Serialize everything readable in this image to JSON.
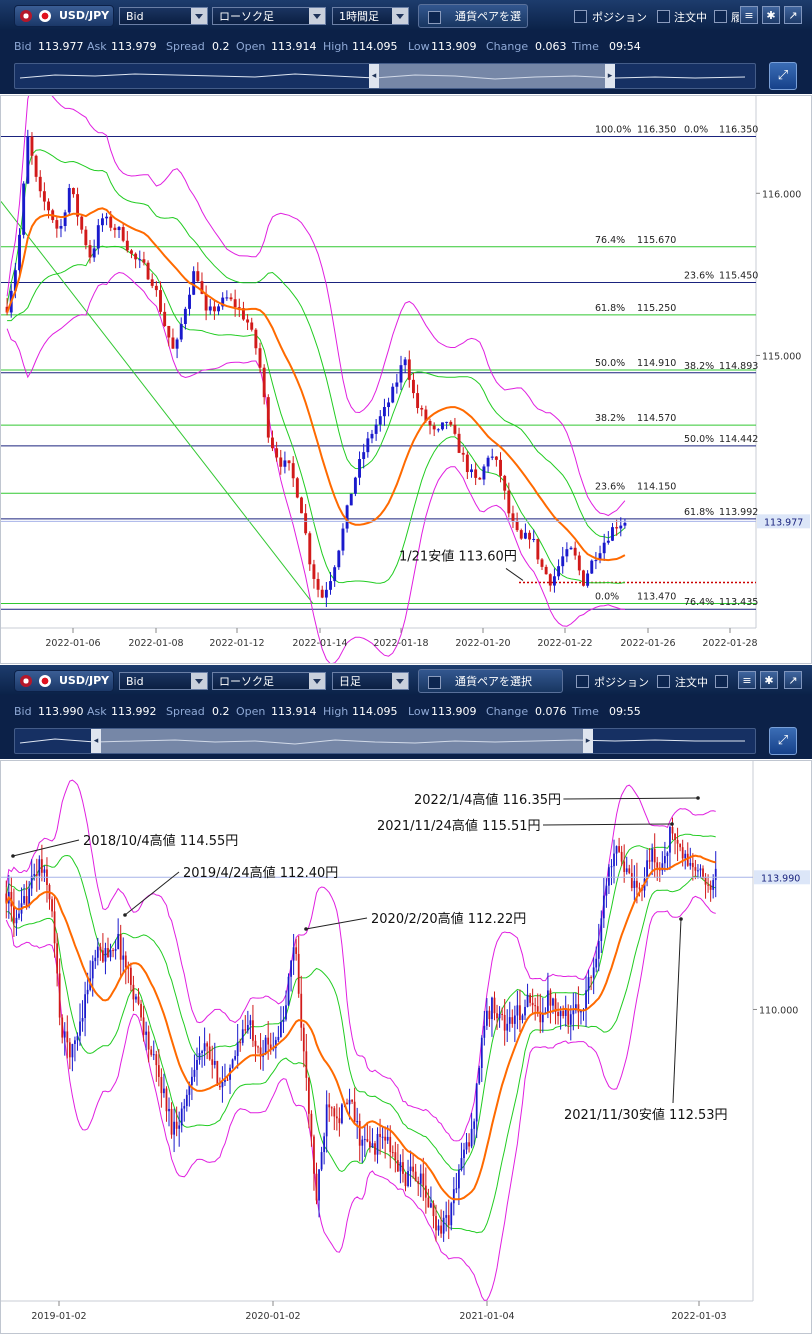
{
  "panels": [
    {
      "symbol": "USD/JPY",
      "price_type": "Bid",
      "chart_style": "ローソク足",
      "timeframe": "1時間足",
      "pair_button": "通貨ペアを選択",
      "position_label": "ポジション",
      "order_label": "注文中",
      "extra_label": "履",
      "quote": {
        "bid_label": "Bid",
        "bid": "113.977",
        "ask_label": "Ask",
        "ask": "113.979",
        "spread_label": "Spread",
        "spread": "0.2",
        "open_label": "Open",
        "open": "113.914",
        "high_label": "High",
        "high": "114.095",
        "low_label": "Low",
        "low": "113.909",
        "change_label": "Change",
        "change": "0.063",
        "time_label": "Time",
        "time": "09:54"
      }
    },
    {
      "symbol": "USD/JPY",
      "price_type": "Bid",
      "chart_style": "ローソク足",
      "timeframe": "日足",
      "pair_button": "通貨ペアを選択",
      "position_label": "ポジション",
      "order_label": "注文中",
      "extra_label": "",
      "quote": {
        "bid_label": "Bid",
        "bid": "113.990",
        "ask_label": "Ask",
        "ask": "113.992",
        "spread_label": "Spread",
        "spread": "0.2",
        "open_label": "Open",
        "open": "113.914",
        "high_label": "High",
        "high": "114.095",
        "low_label": "Low",
        "low": "113.909",
        "change_label": "Change",
        "change": "0.076",
        "time_label": "Time",
        "time": "09:55"
      }
    }
  ],
  "colors": {
    "candle_up": "#1a1acc",
    "candle_down": "#d11a1a",
    "bollinger": "#e020e0",
    "inner_band": "#22cc22",
    "moving_average": "#ff6a00",
    "fib_green": "#32c832",
    "fib_navy": "#1a237e",
    "toolbar": "#0c2148"
  },
  "chart_data": [
    {
      "type": "candlestick",
      "timeframe": "1時間足",
      "x_ticks": [
        "2022-01-06",
        "2022-01-08",
        "2022-01-12",
        "2022-01-14",
        "2022-01-18",
        "2022-01-20",
        "2022-01-22",
        "2022-01-26",
        "2022-01-28"
      ],
      "y_ticks": [
        "116.000",
        "115.000"
      ],
      "ylim": [
        113.35,
        116.6
      ],
      "current_price": "113.977",
      "price_path": [
        115.3,
        115.6,
        116.35,
        116.0,
        115.9,
        115.75,
        116.05,
        115.8,
        115.6,
        115.85,
        115.8,
        115.75,
        115.6,
        115.55,
        115.45,
        115.2,
        115.0,
        115.3,
        115.55,
        115.25,
        115.3,
        115.35,
        115.3,
        115.2,
        115.0,
        114.5,
        114.35,
        114.3,
        114.1,
        113.7,
        113.5,
        113.65,
        113.9,
        114.2,
        114.4,
        114.55,
        114.65,
        114.8,
        115.0,
        114.7,
        114.6,
        114.5,
        114.6,
        114.45,
        114.3,
        114.2,
        114.4,
        114.3,
        114.0,
        113.85,
        113.9,
        113.7,
        113.6,
        113.75,
        113.8,
        113.6,
        113.75,
        113.85,
        113.95,
        113.98
      ],
      "fib_left_green": [
        {
          "level": "100.0%",
          "price": "116.350",
          "y": 116.35
        },
        {
          "level": "76.4%",
          "price": "115.670",
          "y": 115.67
        },
        {
          "level": "61.8%",
          "price": "115.250",
          "y": 115.25
        },
        {
          "level": "50.0%",
          "price": "114.910",
          "y": 114.91
        },
        {
          "level": "38.2%",
          "price": "114.570",
          "y": 114.57
        },
        {
          "level": "23.6%",
          "price": "114.150",
          "y": 114.15
        },
        {
          "level": "0.0%",
          "price": "113.470",
          "y": 113.47
        }
      ],
      "fib_right_navy": [
        {
          "level": "0.0%",
          "price": "116.350",
          "y": 116.35
        },
        {
          "level": "23.6%",
          "price": "115.450",
          "y": 115.45
        },
        {
          "level": "38.2%",
          "price": "114.893",
          "y": 114.893
        },
        {
          "level": "50.0%",
          "price": "114.442",
          "y": 114.442
        },
        {
          "level": "61.8%",
          "price": "113.992",
          "y": 113.992
        },
        {
          "level": "76.4%",
          "price": "113.435",
          "y": 113.435
        }
      ],
      "annotations": [
        {
          "text": "1/21安値 113.60円",
          "y": 113.6
        }
      ]
    },
    {
      "type": "candlestick",
      "timeframe": "日足",
      "x_ticks": [
        "2019-01-02",
        "2020-01-02",
        "2021-01-04",
        "2022-01-03"
      ],
      "y_ticks": [
        "110.000"
      ],
      "ylim": [
        101.2,
        117.5
      ],
      "current_price": "113.990",
      "price_path": [
        113.5,
        112.5,
        113.6,
        114.4,
        113.4,
        109.2,
        108.7,
        110.2,
        111.6,
        111.7,
        112.1,
        111.1,
        110.0,
        108.7,
        107.7,
        106.4,
        107.0,
        108.5,
        108.8,
        108.0,
        107.7,
        109.2,
        109.5,
        108.8,
        109.0,
        109.6,
        112.2,
        108.0,
        104.2,
        107.4,
        106.8,
        107.2,
        106.0,
        105.8,
        106.2,
        105.5,
        104.9,
        105.1,
        104.2,
        103.4,
        103.8,
        105.4,
        106.2,
        109.5,
        110.2,
        109.5,
        109.8,
        110.2,
        109.8,
        110.4,
        110.0,
        109.7,
        110.2,
        111.3,
        113.5,
        115.2,
        114.0,
        113.4,
        114.7,
        114.2,
        115.4,
        114.6,
        114.3,
        113.8,
        114.0
      ],
      "annotations": [
        {
          "text": "2018/10/4高値 114.55円",
          "y": 114.55
        },
        {
          "text": "2019/4/24高値 112.40円",
          "y": 112.4
        },
        {
          "text": "2020/2/20高値 112.22円",
          "y": 112.22
        },
        {
          "text": "2022/1/4高値 116.35円",
          "y": 116.35
        },
        {
          "text": "2021/11/24高値 115.51円",
          "y": 115.51
        },
        {
          "text": "2021/11/30安値 112.53円",
          "y": 112.53
        }
      ]
    }
  ]
}
